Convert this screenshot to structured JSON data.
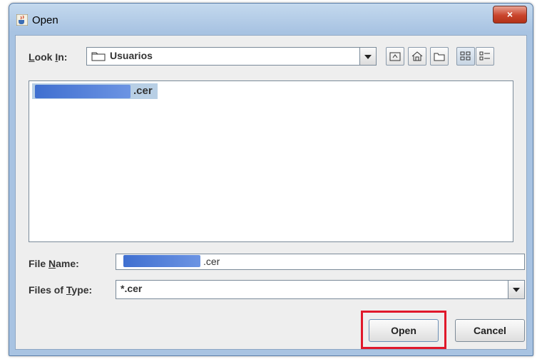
{
  "window": {
    "title": "Open",
    "close_glyph": "×",
    "app_icon": "java-cup-icon"
  },
  "look_in": {
    "label": "Look In:",
    "label_mnemonic": "L",
    "value": "Usuarios",
    "folder_icon": "folder-icon"
  },
  "toolbar": {
    "buttons": [
      {
        "name": "up-one-level-icon"
      },
      {
        "name": "home-icon"
      },
      {
        "name": "new-folder-icon"
      },
      {
        "name": "list-view-icon"
      },
      {
        "name": "details-view-icon"
      }
    ]
  },
  "files": [
    {
      "name_suffix": ".cer",
      "redacted": true,
      "selected": true
    }
  ],
  "file_name": {
    "label": "File Name:",
    "value_suffix": ".cer"
  },
  "files_of_type": {
    "label": "Files of Type:",
    "value": "*.cer"
  },
  "buttons": {
    "open": "Open",
    "cancel": "Cancel"
  },
  "colors": {
    "highlight": "#e0182b",
    "selection": "#b8cfe5",
    "redaction": "#3f6fd0"
  }
}
